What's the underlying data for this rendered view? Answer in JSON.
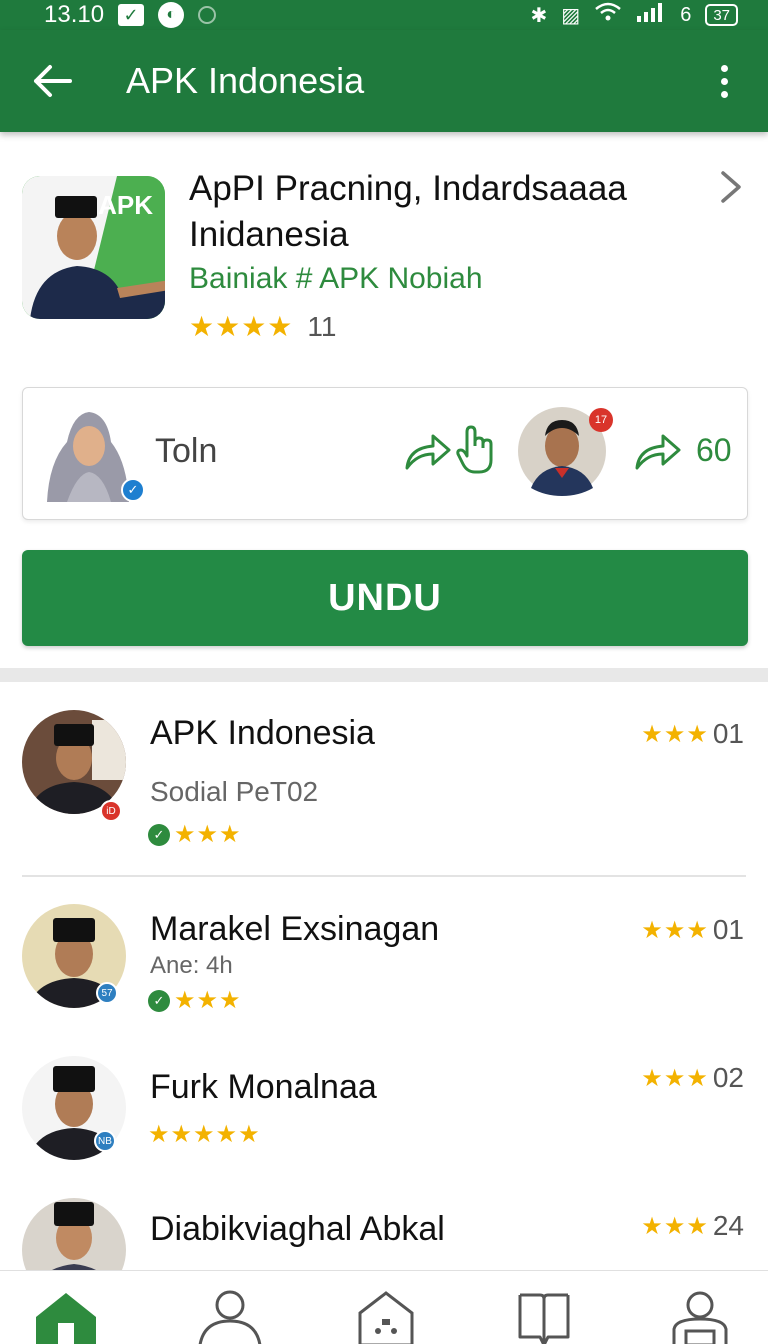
{
  "status_bar": {
    "time": "13.10",
    "network": "6",
    "battery": "37"
  },
  "app_bar": {
    "title": "APK Indonesia"
  },
  "featured": {
    "title": "ApPI Pracning, Indardsaaaa Inidanesia",
    "subtitle": "Bainiak # APK Nobiah",
    "icon_label": "APK",
    "stars": "★★★★",
    "rating_count": "11"
  },
  "social": {
    "name": "Toln",
    "badge": "17",
    "count": "60"
  },
  "download_label": "UNDU",
  "list": [
    {
      "title": "APK Indonesia",
      "subtitle": "Sodial PeT02",
      "stars": "★★★",
      "right_stars": "★★★",
      "right_value": "01",
      "badge": "iD"
    },
    {
      "title": "Marakel Exsinagan",
      "subtitle": "Ane: 4h",
      "stars": "★★★",
      "right_stars": "★★★",
      "right_value": "01",
      "badge": "57"
    },
    {
      "title": "Furk Monalnaa",
      "subtitle": "",
      "stars": "★★★★★",
      "right_stars": "★★★",
      "right_value": "02",
      "badge": "NB"
    },
    {
      "title": "Diabikviaghal Abkal",
      "subtitle": "",
      "stars": "",
      "right_stars": "★★★",
      "right_value": "24",
      "badge": ""
    }
  ],
  "colors": {
    "primary": "#1f7a3d",
    "button": "#238a45",
    "accent_green": "#2e8b3e",
    "star": "#f3b200"
  }
}
